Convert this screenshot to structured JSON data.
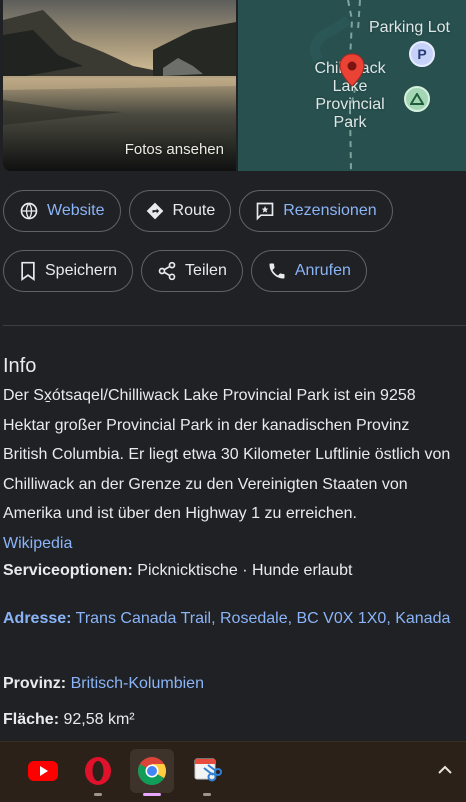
{
  "photo": {
    "caption": "Fotos ansehen"
  },
  "map": {
    "parking_label": "Parking Lot",
    "park_label_lines": [
      "Chilliwack",
      "Lake",
      "Provincial",
      "Park"
    ],
    "parking_icon_letter": "P"
  },
  "actions": {
    "row1": [
      {
        "label": "Website",
        "icon": "globe-icon"
      },
      {
        "label": "Route",
        "icon": "directions-icon"
      },
      {
        "label": "Rezensionen",
        "icon": "review-icon"
      }
    ],
    "row2": [
      {
        "label": "Speichern",
        "icon": "bookmark-icon"
      },
      {
        "label": "Teilen",
        "icon": "share-icon"
      },
      {
        "label": "Anrufen",
        "icon": "phone-icon"
      }
    ]
  },
  "info": {
    "title": "Info",
    "description": "Der Sx̱ótsaqel/Chilliwack Lake Provincial Park ist ein 9258 Hektar großer Provincial Park in der kanadischen Provinz British Columbia. Er liegt etwa 30 Kilometer Luftlinie östlich von Chilliwack an der Grenze zu den Vereinigten Staaten von Amerika und ist über den Highway 1 zu erreichen.",
    "source_link": "Wikipedia"
  },
  "details": {
    "service_label": "Serviceoptionen:",
    "service_value": "Picknicktische · Hunde erlaubt",
    "address_label": "Adresse:",
    "address_value": "Trans Canada Trail, Rosedale, BC V0X 1X0, Kanada",
    "province_label": "Provinz:",
    "province_value": "Britisch-Kolumbien",
    "area_label": "Fläche:",
    "area_value": "92,58 km²"
  },
  "taskbar": {
    "apps": [
      "youtube-icon",
      "opera-icon",
      "chrome-icon",
      "snipping-tool-icon"
    ],
    "active_app": "chrome-icon"
  },
  "colors": {
    "background": "#202124",
    "link": "#8ab4f8",
    "text": "#e8eaed",
    "taskbar": "#2b2119"
  }
}
